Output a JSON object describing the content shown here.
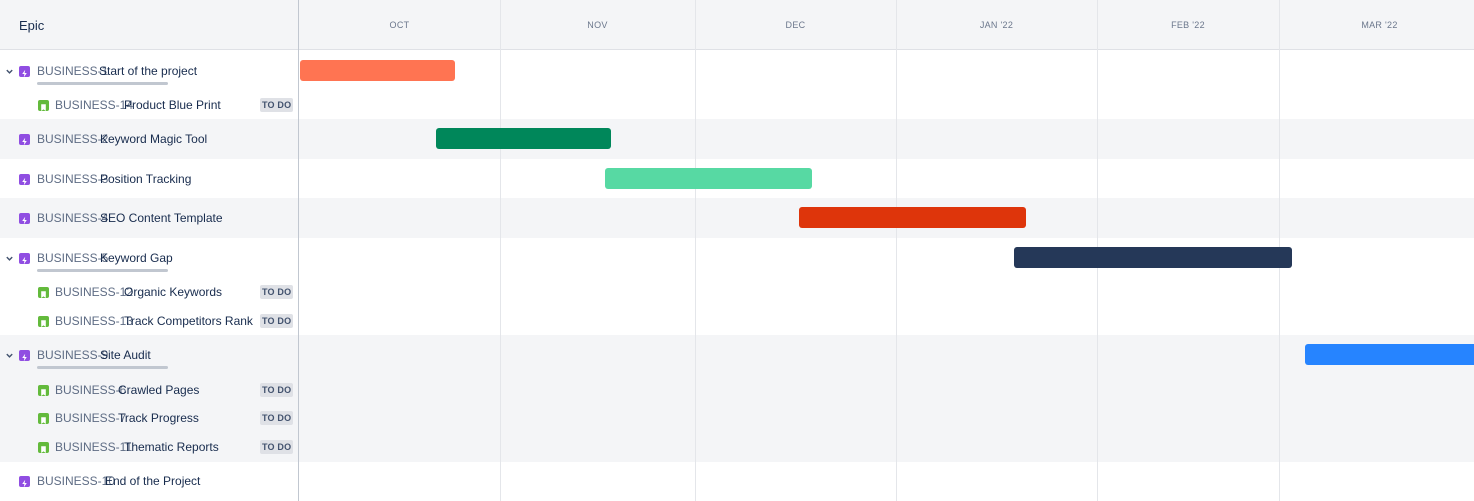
{
  "header": {
    "epic_label": "Epic",
    "months": [
      "OCT",
      "NOV",
      "DEC",
      "JAN '22",
      "FEB '22",
      "MAR '22"
    ]
  },
  "rows": [
    {
      "type": "epic",
      "key": "BUSINESS-1",
      "title": "Start of the project",
      "expandable": true
    },
    {
      "type": "story",
      "key": "BUSINESS-14",
      "title": "Product Blue Print",
      "status": "TO DO"
    },
    {
      "type": "epic",
      "key": "BUSINESS-2",
      "title": "Keyword Magic Tool",
      "expandable": false
    },
    {
      "type": "epic",
      "key": "BUSINESS-3",
      "title": "Position Tracking",
      "expandable": false
    },
    {
      "type": "epic",
      "key": "BUSINESS-4",
      "title": "SEO Content Template",
      "expandable": false
    },
    {
      "type": "epic",
      "key": "BUSINESS-5",
      "title": "Keyword Gap",
      "expandable": true
    },
    {
      "type": "story",
      "key": "BUSINESS-12",
      "title": "Organic Keywords",
      "status": "TO DO"
    },
    {
      "type": "story",
      "key": "BUSINESS-13",
      "title": "Track Competitors Rank",
      "status": "TO DO"
    },
    {
      "type": "epic",
      "key": "BUSINESS-9",
      "title": "Site Audit",
      "expandable": true
    },
    {
      "type": "story",
      "key": "BUSINESS-6",
      "title": "Crawled Pages",
      "status": "TO DO"
    },
    {
      "type": "story",
      "key": "BUSINESS-7",
      "title": "Track Progress",
      "status": "TO DO"
    },
    {
      "type": "story",
      "key": "BUSINESS-11",
      "title": "Thematic Reports",
      "status": "TO DO"
    },
    {
      "type": "epic",
      "key": "BUSINESS-10",
      "title": "End of the Project",
      "expandable": false
    }
  ],
  "bar_colors": {
    "BUSINESS-1": "#ff7452",
    "BUSINESS-2": "#00875a",
    "BUSINESS-3": "#57d9a3",
    "BUSINESS-4": "#de350b",
    "BUSINESS-5": "#253858",
    "BUSINESS-9": "#2684ff"
  },
  "icons": {
    "epic": "lightning-icon",
    "story": "bookmark-icon",
    "expand": "chevron-down-icon"
  }
}
